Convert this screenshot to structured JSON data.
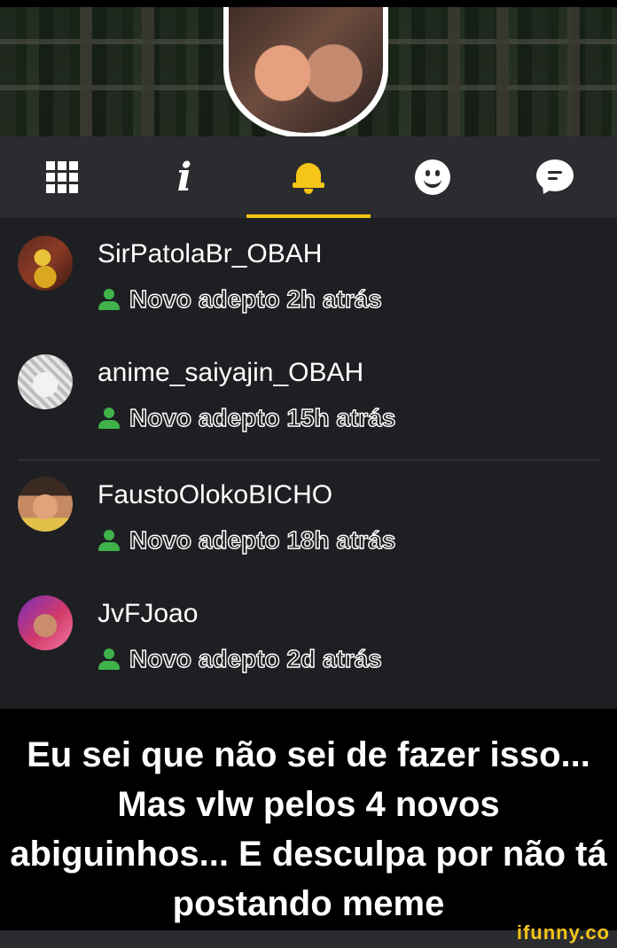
{
  "tabs": [
    {
      "icon": "grid-icon"
    },
    {
      "icon": "info-icon",
      "glyph": "i"
    },
    {
      "icon": "bell-icon",
      "active": true
    },
    {
      "icon": "smiley-icon"
    },
    {
      "icon": "chat-icon"
    }
  ],
  "notifications": [
    {
      "username": "SirPatolaBr_OBAH",
      "status": "Novo adepto 2h atrás"
    },
    {
      "username": "anime_saiyajin_OBAH",
      "status": "Novo adepto 15h atrás"
    },
    {
      "username": "FaustoOlokoBICHO",
      "status": "Novo adepto 18h atrás"
    },
    {
      "username": "JvFJoao",
      "status": "Novo adepto 2d atrás"
    }
  ],
  "caption": "Eu sei que não sei de fazer isso... Mas vlw pelos 4 novos abiguinhos... E desculpa por não tá postando meme",
  "watermark": "ifunny.co",
  "colors": {
    "accent": "#f5c518",
    "tabbar": "#2b2c2f",
    "list_bg": "#1e1f22",
    "follow_green": "#3fb24a"
  }
}
